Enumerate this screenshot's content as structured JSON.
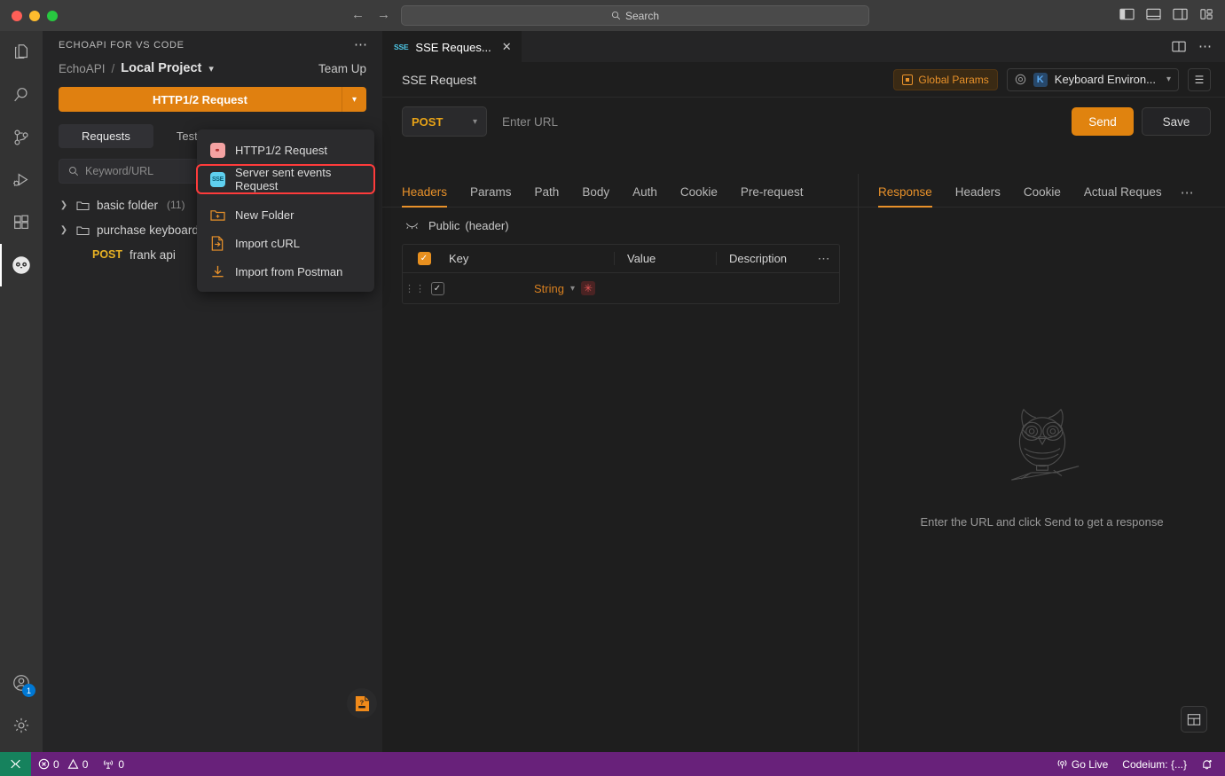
{
  "titlebar": {
    "search_placeholder": "Search",
    "search_icon": "search-icon",
    "back_icon": "←",
    "forward_icon": "→",
    "layout_icons": [
      "toggle-primary-sidebar-icon",
      "toggle-panel-icon",
      "toggle-secondary-sidebar-icon",
      "customize-layout-icon"
    ]
  },
  "activitybar": {
    "items": [
      {
        "name": "explorer",
        "icon": "files-icon"
      },
      {
        "name": "search",
        "icon": "search-icon"
      },
      {
        "name": "source-control",
        "icon": "source-control-icon"
      },
      {
        "name": "run-debug",
        "icon": "run-and-debug-icon"
      },
      {
        "name": "extensions",
        "icon": "extensions-icon"
      },
      {
        "name": "echoapi",
        "icon": "echoapi-owl-icon",
        "active": true
      }
    ],
    "bottom": [
      {
        "name": "accounts",
        "icon": "account-icon",
        "badge": "1"
      },
      {
        "name": "manage",
        "icon": "gear-icon"
      }
    ]
  },
  "sidebar": {
    "title": "ECHOAPI FOR VS CODE",
    "more_icon": "ellipsis-icon",
    "breadcrumb": {
      "root": "EchoAPI",
      "separator": "/",
      "current": "Local Project",
      "chevron": "chevron-down-icon"
    },
    "team_up": "Team Up",
    "new_button": {
      "label": "HTTP1/2 Request",
      "split_chevron": "chevron-down-icon"
    },
    "segments": [
      {
        "label": "Requests",
        "active": true
      },
      {
        "label": "Tests",
        "active": false
      }
    ],
    "search": {
      "placeholder": "Keyword/URL",
      "icon": "search-icon"
    },
    "tree": [
      {
        "type": "folder",
        "label": "basic folder",
        "count": "(11)",
        "chevron": "chevron-right-icon"
      },
      {
        "type": "folder",
        "label": "purchase keyboard",
        "count": "",
        "chevron": "chevron-right-icon"
      },
      {
        "type": "request",
        "method": "POST",
        "label": "frank api"
      }
    ],
    "help_icon": "help-document-icon"
  },
  "dropdown": {
    "items": [
      {
        "label": "HTTP1/2 Request",
        "icon": "http-request-icon",
        "icon_text": "API",
        "highlighted": false
      },
      {
        "label": "Server sent events Request",
        "icon": "sse-request-icon",
        "icon_text": "SSE",
        "highlighted": true
      },
      {
        "label": "New Folder",
        "icon": "new-folder-icon",
        "highlighted": false
      },
      {
        "label": "Import cURL",
        "icon": "import-curl-icon",
        "highlighted": false
      },
      {
        "label": "Import from Postman",
        "icon": "import-postman-icon",
        "highlighted": false
      }
    ],
    "highlight_color": "#ff3b3b"
  },
  "editor": {
    "tab": {
      "label": "SSE Reques...",
      "icon_text": "SSE",
      "close_icon": "close-icon"
    },
    "tabstrip_right": {
      "split_icon": "split-editor-icon",
      "more_icon": "ellipsis-icon"
    },
    "request_title": "SSE Request",
    "global_params": {
      "label": "Global Params",
      "icon": "global-params-icon"
    },
    "environment": {
      "icon": "environment-icon",
      "badge": "K",
      "label": "Keyboard Environ...",
      "chevron": "chevron-down-icon"
    },
    "menu_icon": "hamburger-icon",
    "url_row": {
      "method": "POST",
      "method_chevron": "chevron-down-icon",
      "url_placeholder": "Enter URL",
      "send_label": "Send",
      "save_label": "Save"
    },
    "request_tabs": [
      {
        "label": "Headers",
        "active": true
      },
      {
        "label": "Params",
        "active": false
      },
      {
        "label": "Path",
        "active": false
      },
      {
        "label": "Body",
        "active": false
      },
      {
        "label": "Auth",
        "active": false
      },
      {
        "label": "Cookie",
        "active": false
      },
      {
        "label": "Pre-request",
        "active": false
      }
    ],
    "public_row": {
      "icon": "eye-closed-icon",
      "label": "Public",
      "sub": "(header)"
    },
    "headers_table": {
      "columns": [
        "Key",
        "Value",
        "Description"
      ],
      "more_icon": "ellipsis-icon",
      "header_checkbox_checked": true,
      "rows": [
        {
          "drag": "drag-handle-icon",
          "checked": true,
          "key": "",
          "type": "String",
          "type_chevron": "chevron-down-icon",
          "required_marker": "✳",
          "value": "",
          "description": ""
        }
      ]
    },
    "response_tabs": [
      {
        "label": "Response",
        "active": true
      },
      {
        "label": "Headers",
        "active": false
      },
      {
        "label": "Cookie",
        "active": false
      },
      {
        "label": "Actual Reques",
        "active": false
      }
    ],
    "response_more_icon": "ellipsis-icon",
    "response_empty": {
      "illustration": "owl-illustration",
      "text": "Enter the URL and click Send to get a response"
    },
    "panel_toggle_icon": "layout-panel-icon"
  },
  "statusbar": {
    "remote_icon": "remote-window-icon",
    "errors": {
      "icon": "error-icon",
      "count": "0"
    },
    "warnings": {
      "icon": "warning-icon",
      "count": "0"
    },
    "ports": {
      "icon": "radio-tower-icon",
      "count": "0"
    },
    "go_live": {
      "icon": "broadcast-icon",
      "label": "Go Live"
    },
    "codeium": "Codeium: {...}",
    "bell_icon": "notifications-icon",
    "background": "#68217a"
  },
  "colors": {
    "accent_orange": "#e0830f",
    "highlight_red": "#ff3b3b",
    "status_purple": "#68217a",
    "remote_green": "#16825d"
  }
}
